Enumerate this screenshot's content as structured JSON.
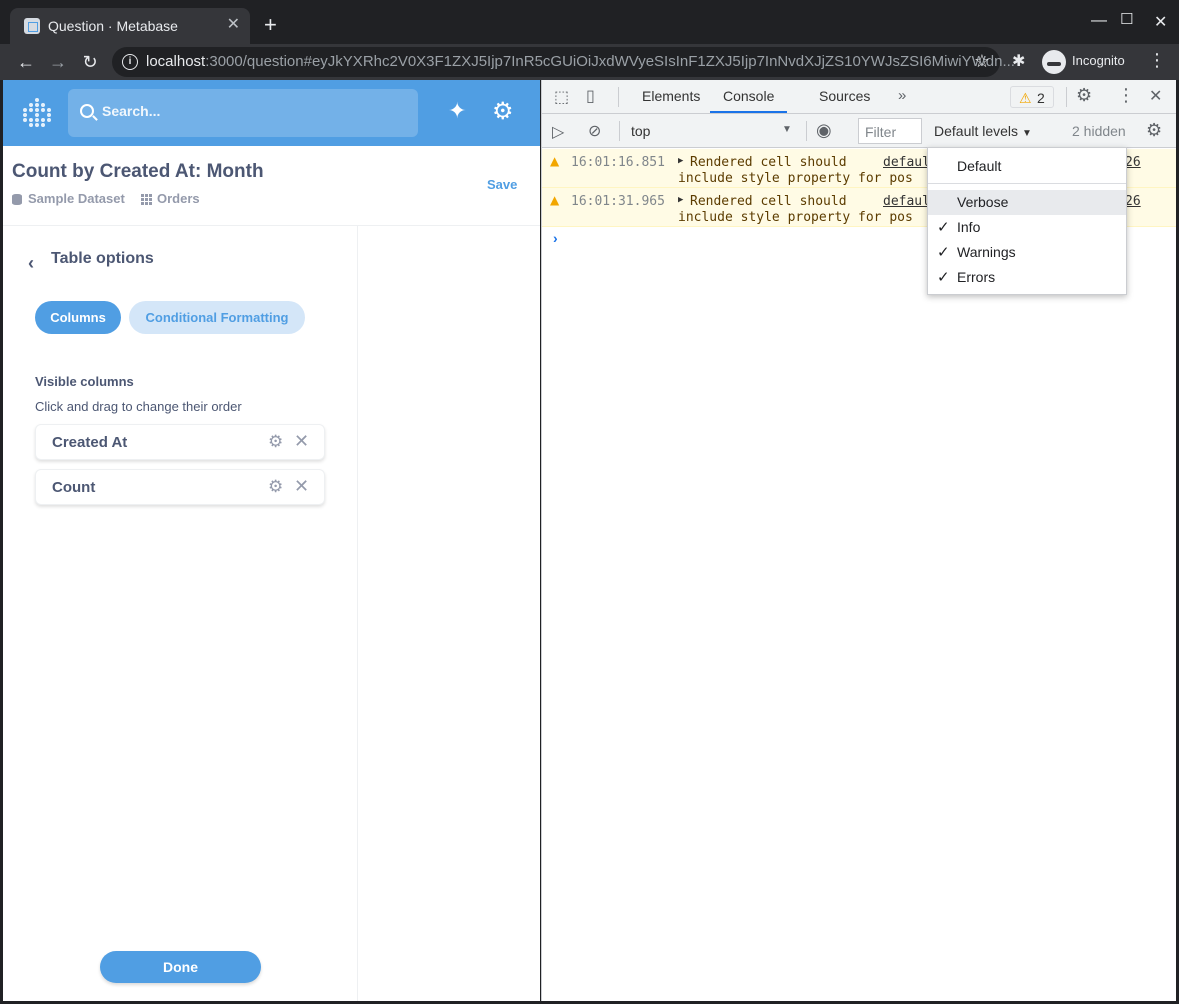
{
  "browser": {
    "tab_title": "Question · Metabase",
    "url_host": "localhost",
    "url_path": ":3000/question#eyJkYXRhc2V0X3F1ZXJ5Ijp7InR5cGUiOiJxdWVyeSIsInF1ZXJ5Ijp7InNvdXJjZS10YWJsZSI6MiwiYWdn...",
    "profile_label": "Incognito"
  },
  "metabase": {
    "search_placeholder": "Search...",
    "question_title": "Count by Created At: Month",
    "save_label": "Save",
    "breadcrumb_dataset": "Sample Dataset",
    "breadcrumb_table": "Orders",
    "sidebar": {
      "title": "Table options",
      "tabs": [
        {
          "label": "Columns",
          "active": true
        },
        {
          "label": "Conditional Formatting",
          "active": false
        }
      ],
      "section_title": "Visible columns",
      "section_hint": "Click and drag to change their order",
      "columns": [
        {
          "name": "Created At"
        },
        {
          "name": "Count"
        }
      ],
      "done_label": "Done"
    }
  },
  "devtools": {
    "tabs": [
      "Elements",
      "Console",
      "Sources"
    ],
    "active_tab": "Console",
    "warning_count": "2",
    "context": "top",
    "filter_placeholder": "Filter",
    "levels_label": "Default levels",
    "hidden_label": "2 hidden",
    "messages": [
      {
        "time": "16:01:16.851",
        "text_line1": "Rendered cell should",
        "text_line2": "include style property for pos",
        "source": "defaul",
        "line": "26"
      },
      {
        "time": "16:01:31.965",
        "text_line1": "Rendered cell should",
        "text_line2": "include style property for pos",
        "source": "defaul",
        "line": "26"
      }
    ],
    "levels_menu": {
      "default_item": "Default",
      "items": [
        {
          "label": "Verbose",
          "checked": false,
          "highlighted": true
        },
        {
          "label": "Info",
          "checked": true,
          "highlighted": false
        },
        {
          "label": "Warnings",
          "checked": true,
          "highlighted": false
        },
        {
          "label": "Errors",
          "checked": true,
          "highlighted": false
        }
      ]
    }
  },
  "colors": {
    "metabase_brand": "#509ee3",
    "warning": "#f2a600"
  }
}
